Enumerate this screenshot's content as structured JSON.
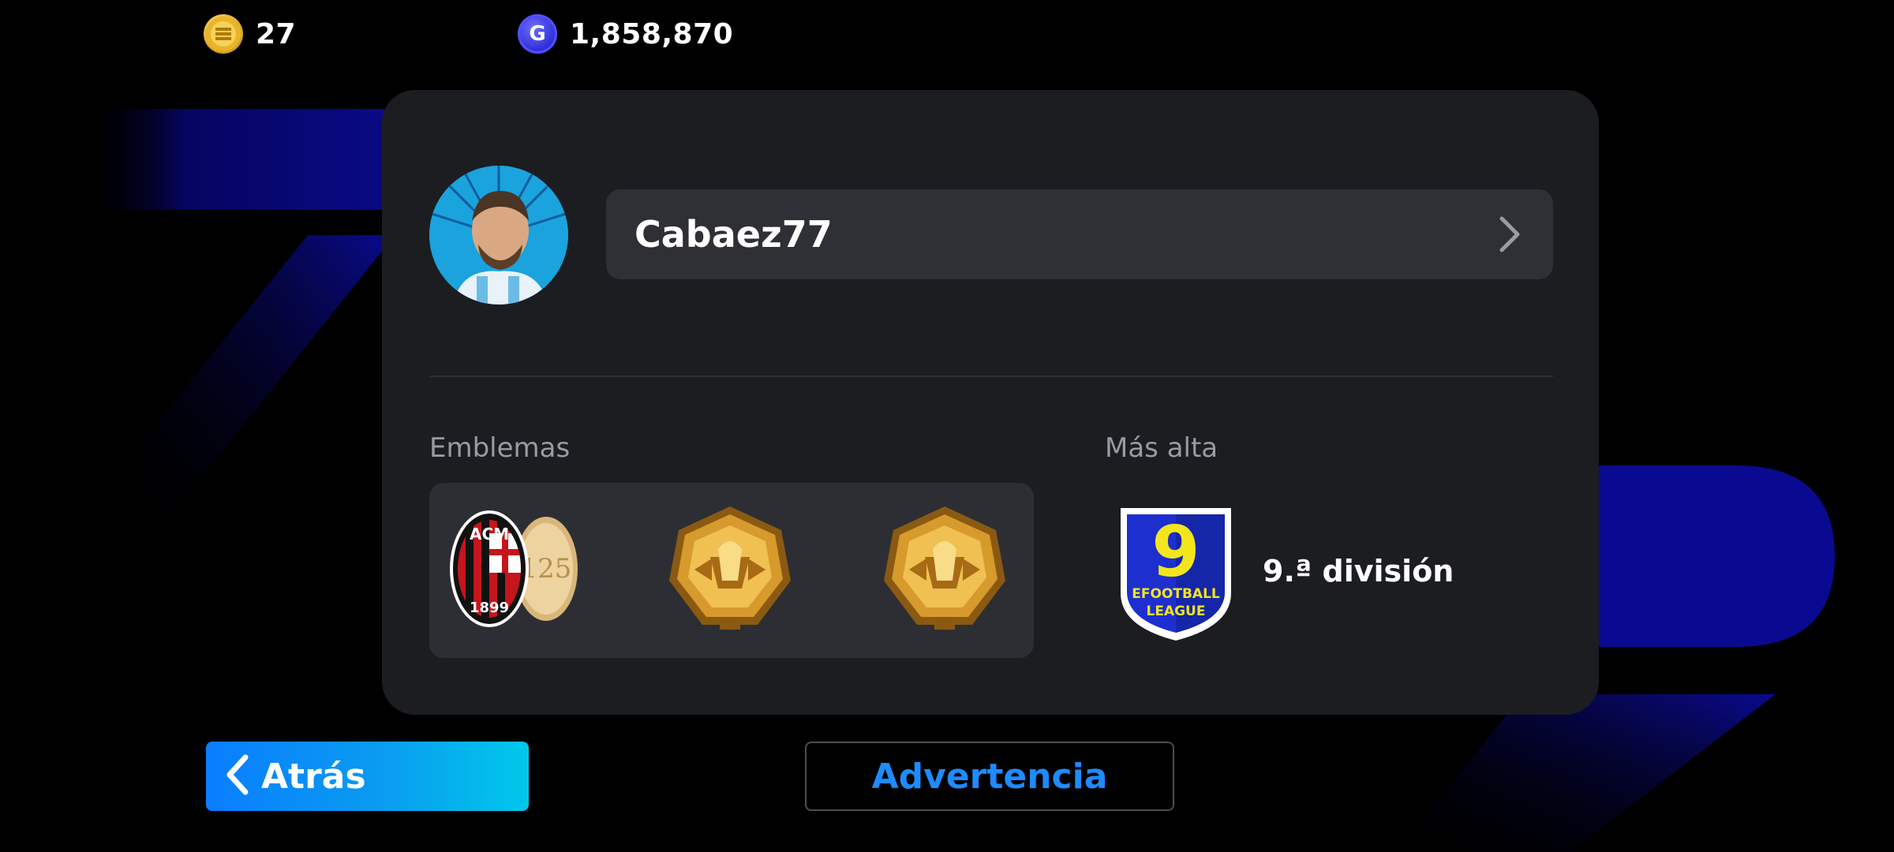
{
  "currency": {
    "coins": {
      "icon": "efootball-coin-icon",
      "value": "27",
      "color": "#f2c230"
    },
    "gp": {
      "icon": "gp-icon",
      "value": "1,858,870",
      "color": "#2b2bd8",
      "icon_letter": "G"
    }
  },
  "profile": {
    "avatar_icon": "player-avatar",
    "name": "Cabaez77"
  },
  "emblems": {
    "label": "Emblemas",
    "items": [
      {
        "icon": "ac-milan-125-emblem-icon"
      },
      {
        "icon": "gold-trophy-emblem-icon"
      },
      {
        "icon": "gold-trophy-emblem-icon"
      }
    ]
  },
  "highest": {
    "label": "Más alta",
    "badge": {
      "icon": "efootball-league-badge-icon",
      "number": "9",
      "line1": "EFOOTBALL",
      "line2": "LEAGUE"
    },
    "division": "9.ª división"
  },
  "buttons": {
    "back": "Atrás",
    "warning": "Advertencia"
  },
  "colors": {
    "accent_blue": "#1e8bff",
    "card_bg": "#1c1d21",
    "bg_stripes": "#0a0a8a"
  }
}
